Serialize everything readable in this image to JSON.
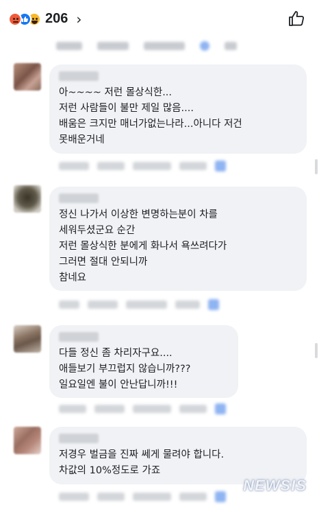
{
  "header": {
    "reaction_icons": [
      "angry-icon",
      "like-icon",
      "haha-icon"
    ],
    "reaction_count": "206",
    "chevron": "›",
    "like_button_icon": "thumbs-up-icon"
  },
  "comments": [
    {
      "lines": [
        "아~~~~ 저런 몰상식한...",
        "저런 사람들이 불만 제일 많음....",
        "배움은 크지만 매너가없는나라...아니다 저건",
        "못배운거네"
      ]
    },
    {
      "lines": [
        "정신 나가서 이상한 변명하는분이 차를",
        "세워두셨군요 순간",
        "저런 몰상식한 분에게 화나서 욕쓰려다가",
        "그러면 절대 안되니까",
        "참네요"
      ]
    },
    {
      "lines": [
        "다들 정신 좀 차리자구요....",
        "애들보기 부끄럽지 않습니까???",
        "일요일엔 불이 안난답니까!!!"
      ]
    },
    {
      "lines": [
        "저경우 벌금을 진짜 쎄게 물려야 합니다.",
        "차값의 10%정도로 가죠"
      ]
    }
  ],
  "watermark": "NEWSIS",
  "colors": {
    "bubble": "#f0f2f5",
    "text": "#1c1e21",
    "like_blue": "#1877f2"
  }
}
